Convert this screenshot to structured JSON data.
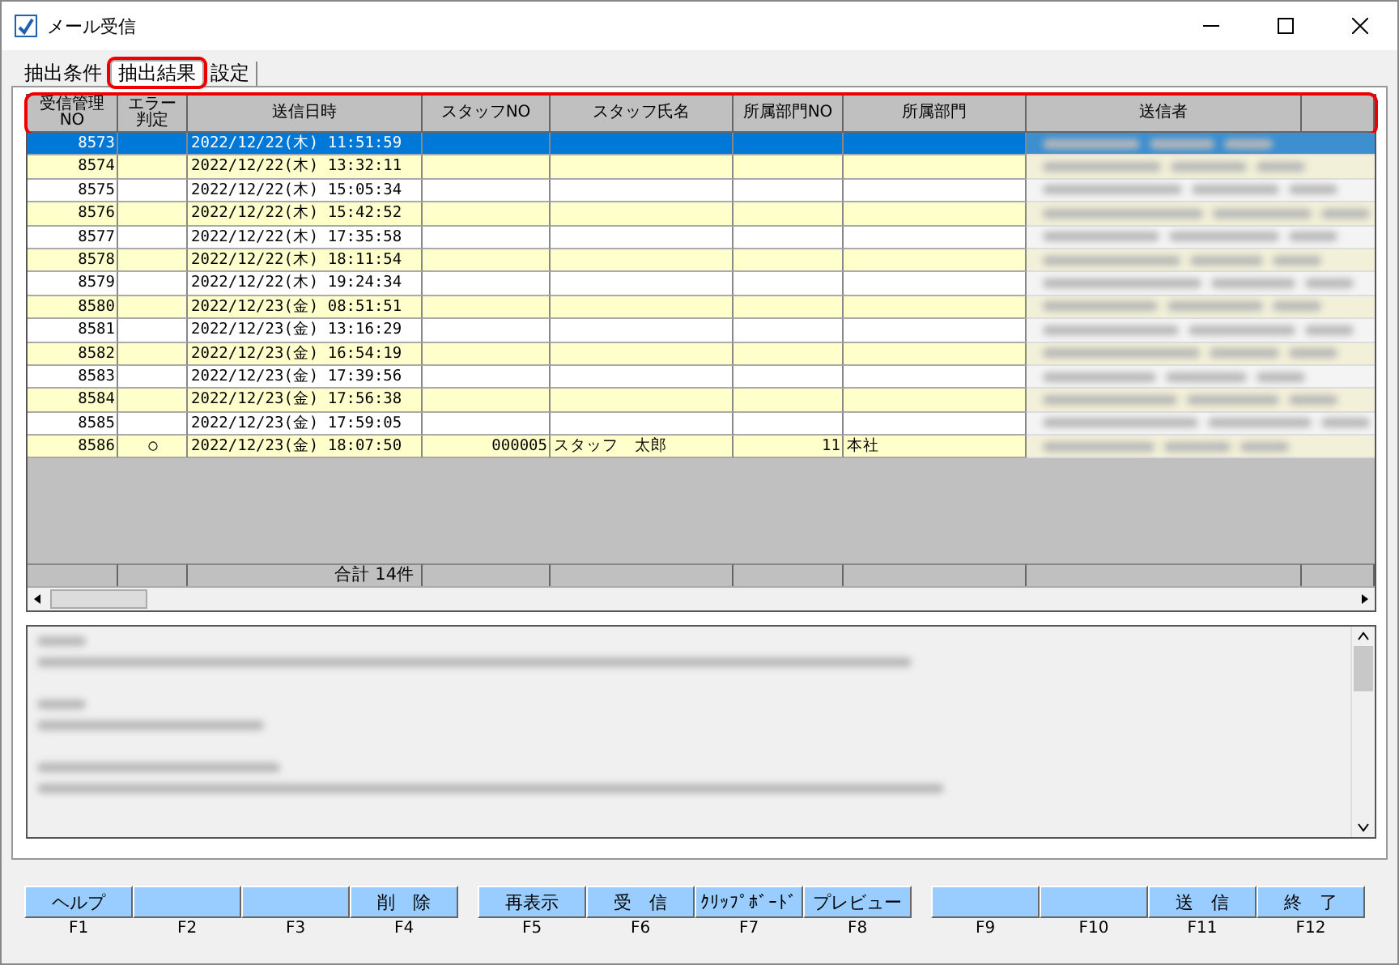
{
  "window": {
    "title": "メール受信"
  },
  "tabs": [
    {
      "label": "抽出条件",
      "selected": false,
      "highlighted": false
    },
    {
      "label": "抽出結果",
      "selected": true,
      "highlighted": true
    },
    {
      "label": "設定",
      "selected": false,
      "highlighted": false
    }
  ],
  "table": {
    "header_highlighted": true,
    "columns": [
      {
        "lines": [
          "受信管理",
          "NO"
        ]
      },
      {
        "lines": [
          "エラー",
          "判定"
        ]
      },
      {
        "lines": [
          "送信日時"
        ]
      },
      {
        "lines": [
          "スタッフNO"
        ]
      },
      {
        "lines": [
          "スタッフ氏名"
        ]
      },
      {
        "lines": [
          "所属部門NO"
        ]
      },
      {
        "lines": [
          "所属部門"
        ]
      },
      {
        "lines": [
          "送信者"
        ]
      }
    ],
    "rows": [
      {
        "selected": true,
        "cells": [
          "8573",
          "",
          "2022/12/22(木) 11:51:59",
          "",
          "",
          "",
          ""
        ]
      },
      {
        "selected": false,
        "cells": [
          "8574",
          "",
          "2022/12/22(木) 13:32:11",
          "",
          "",
          "",
          ""
        ]
      },
      {
        "selected": false,
        "cells": [
          "8575",
          "",
          "2022/12/22(木) 15:05:34",
          "",
          "",
          "",
          ""
        ]
      },
      {
        "selected": false,
        "cells": [
          "8576",
          "",
          "2022/12/22(木) 15:42:52",
          "",
          "",
          "",
          ""
        ]
      },
      {
        "selected": false,
        "cells": [
          "8577",
          "",
          "2022/12/22(木) 17:35:58",
          "",
          "",
          "",
          ""
        ]
      },
      {
        "selected": false,
        "cells": [
          "8578",
          "",
          "2022/12/22(木) 18:11:54",
          "",
          "",
          "",
          ""
        ]
      },
      {
        "selected": false,
        "cells": [
          "8579",
          "",
          "2022/12/22(木) 19:24:34",
          "",
          "",
          "",
          ""
        ]
      },
      {
        "selected": false,
        "cells": [
          "8580",
          "",
          "2022/12/23(金) 08:51:51",
          "",
          "",
          "",
          ""
        ]
      },
      {
        "selected": false,
        "cells": [
          "8581",
          "",
          "2022/12/23(金) 13:16:29",
          "",
          "",
          "",
          ""
        ]
      },
      {
        "selected": false,
        "cells": [
          "8582",
          "",
          "2022/12/23(金) 16:54:19",
          "",
          "",
          "",
          ""
        ]
      },
      {
        "selected": false,
        "cells": [
          "8583",
          "",
          "2022/12/23(金) 17:39:56",
          "",
          "",
          "",
          ""
        ]
      },
      {
        "selected": false,
        "cells": [
          "8584",
          "",
          "2022/12/23(金) 17:56:38",
          "",
          "",
          "",
          ""
        ]
      },
      {
        "selected": false,
        "cells": [
          "8585",
          "",
          "2022/12/23(金) 17:59:05",
          "",
          "",
          "",
          ""
        ]
      },
      {
        "selected": false,
        "cells": [
          "8586",
          "○",
          "2022/12/23(金) 18:07:50",
          "000005",
          "スタッフ　太郎",
          "11",
          "本社"
        ]
      }
    ],
    "total": "合計 14件"
  },
  "function_keys": [
    {
      "label": "ヘルプ",
      "key": "F1"
    },
    {
      "key": "F2"
    },
    {
      "key": "F3"
    },
    {
      "label": "削　除",
      "key": "F4"
    },
    {
      "label": "再表示",
      "key": "F5"
    },
    {
      "label": "受　信",
      "key": "F6"
    },
    {
      "label": "ｸﾘｯﾌﾟﾎﾞｰﾄﾞ",
      "key": "F7"
    },
    {
      "label": "プレビュー",
      "key": "F8"
    },
    {
      "key": "F9"
    },
    {
      "key": "F10"
    },
    {
      "label": "送　信",
      "key": "F11"
    },
    {
      "label": "終　了",
      "key": "F12"
    }
  ]
}
